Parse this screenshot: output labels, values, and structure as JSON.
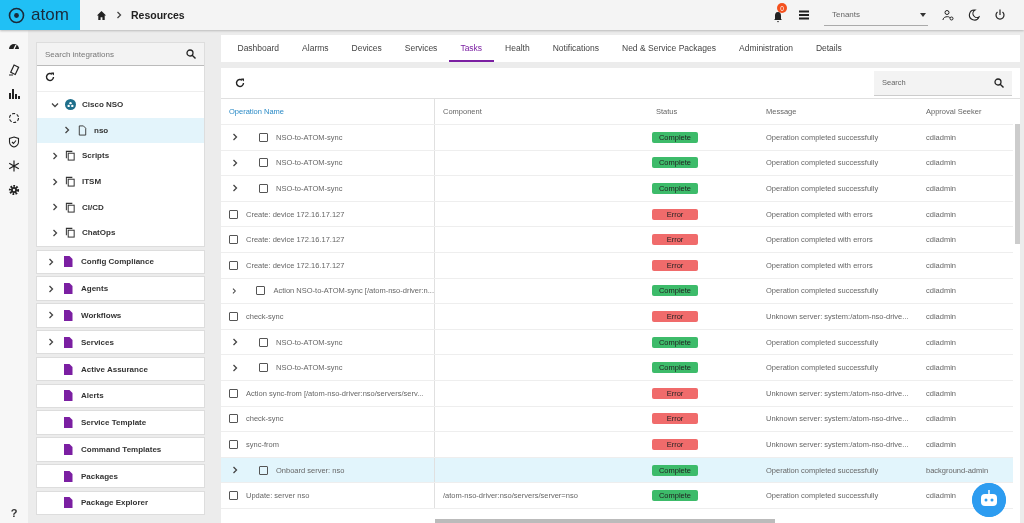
{
  "header": {
    "logo_text": "atom",
    "breadcrumb": "Resources",
    "notification_count": "0",
    "tenant_placeholder": "Tenants"
  },
  "rail": {
    "help_label": "?"
  },
  "integrations": {
    "search_placeholder": "Search integrations",
    "tree": [
      {
        "label": "Cisco NSO",
        "kind": "logo",
        "expanded": true,
        "children": [
          {
            "label": "nso",
            "kind": "file",
            "selected": true,
            "expanded": false
          }
        ]
      },
      {
        "label": "Scripts",
        "kind": "folder",
        "expanded": false
      },
      {
        "label": "ITSM",
        "kind": "folder",
        "expanded": false
      },
      {
        "label": "CI/CD",
        "kind": "folder",
        "expanded": false
      },
      {
        "label": "ChatOps",
        "kind": "folder",
        "expanded": false
      }
    ],
    "sections": [
      {
        "label": "Config Compliance",
        "kind": "group"
      },
      {
        "label": "Agents",
        "kind": "group"
      },
      {
        "label": "Workflows",
        "kind": "group"
      },
      {
        "label": "Services",
        "kind": "group"
      },
      {
        "label": "Active Assurance",
        "kind": "leaf"
      },
      {
        "label": "Alerts",
        "kind": "leaf"
      },
      {
        "label": "Service Template",
        "kind": "leaf"
      },
      {
        "label": "Command Templates",
        "kind": "leaf"
      },
      {
        "label": "Packages",
        "kind": "leaf"
      },
      {
        "label": "Package Explorer",
        "kind": "leaf"
      }
    ]
  },
  "tabs": [
    {
      "label": "Dashboard",
      "selected": false
    },
    {
      "label": "Alarms",
      "selected": false
    },
    {
      "label": "Devices",
      "selected": false
    },
    {
      "label": "Services",
      "selected": false
    },
    {
      "label": "Tasks",
      "selected": true
    },
    {
      "label": "Health",
      "selected": false
    },
    {
      "label": "Notifications",
      "selected": false
    },
    {
      "label": "Ned & Service Packages",
      "selected": false
    },
    {
      "label": "Administration",
      "selected": false
    },
    {
      "label": "Details",
      "selected": false
    }
  ],
  "table": {
    "search_placeholder": "Search",
    "columns": [
      "Operation Name",
      "Component",
      "Status",
      "Message",
      "Approval Seeker"
    ],
    "rows": [
      {
        "kind": "child",
        "name": "NSO-to-ATOM-sync",
        "status": "Complete",
        "color": "#3dbb6a",
        "message": "Operation completed successfully",
        "seeker": "cdiadmin",
        "selected": false
      },
      {
        "kind": "child",
        "name": "NSO-to-ATOM-sync",
        "status": "Complete",
        "color": "#3dbb6a",
        "message": "Operation completed successfully",
        "seeker": "cdiadmin",
        "selected": false
      },
      {
        "kind": "child",
        "name": "NSO-to-ATOM-sync",
        "status": "Complete",
        "color": "#3dbb6a",
        "message": "Operation completed successfully",
        "seeker": "cdiadmin",
        "selected": false
      },
      {
        "kind": "plain",
        "name": "Create: device 172.16.17.127",
        "status": "Error",
        "color": "#f06b6b",
        "message": "Operation completed with errors",
        "seeker": "cdiadmin",
        "selected": false
      },
      {
        "kind": "plain",
        "name": "Create: device 172.16.17.127",
        "status": "Error",
        "color": "#f06b6b",
        "message": "Operation completed with errors",
        "seeker": "cdiadmin",
        "selected": false
      },
      {
        "kind": "plain",
        "name": "Create: device 172.16.17.127",
        "status": "Error",
        "color": "#f06b6b",
        "message": "Operation completed with errors",
        "seeker": "cdiadmin",
        "selected": false
      },
      {
        "kind": "child",
        "name": "Action NSO-to-ATOM-sync [/atom-nso-driver:n...",
        "status": "Complete",
        "color": "#3dbb6a",
        "message": "Operation completed successfully",
        "seeker": "cdiadmin",
        "selected": false
      },
      {
        "kind": "plain",
        "name": "check-sync",
        "status": "Error",
        "color": "#f06b6b",
        "message": "Unknown server: system:/atom-nso-drive...",
        "seeker": "cdiadmin",
        "selected": false
      },
      {
        "kind": "child",
        "name": "NSO-to-ATOM-sync",
        "status": "Complete",
        "color": "#3dbb6a",
        "message": "Operation completed successfully",
        "seeker": "cdiadmin",
        "selected": false
      },
      {
        "kind": "child",
        "name": "NSO-to-ATOM-sync",
        "status": "Complete",
        "color": "#3dbb6a",
        "message": "Operation completed successfully",
        "seeker": "cdiadmin",
        "selected": false
      },
      {
        "kind": "plain",
        "name": "Action sync-from [/atom-nso-driver:nso/servers/serv...",
        "status": "Error",
        "color": "#f06b6b",
        "message": "Unknown server: system:/atom-nso-drive...",
        "seeker": "cdiadmin",
        "selected": false
      },
      {
        "kind": "plain",
        "name": "check-sync",
        "status": "Error",
        "color": "#f06b6b",
        "message": "Unknown server: system:/atom-nso-drive...",
        "seeker": "cdiadmin",
        "selected": false
      },
      {
        "kind": "plain",
        "name": "sync-from",
        "status": "Error",
        "color": "#f06b6b",
        "message": "Unknown server: system:/atom-nso-drive...",
        "seeker": "cdiadmin",
        "selected": false
      },
      {
        "kind": "child",
        "name": "Onboard server: nso",
        "status": "Complete",
        "color": "#3dbb6a",
        "message": "Operation completed successfully",
        "seeker": "background-admin",
        "selected": true
      },
      {
        "kind": "plain",
        "name": "Update: server nso",
        "component": "/atom-nso-driver:nso/servers/server=nso",
        "status": "Complete",
        "color": "#3dbb6a",
        "message": "Operation completed successfully",
        "seeker": "cdiadmin",
        "selected": false
      }
    ]
  }
}
